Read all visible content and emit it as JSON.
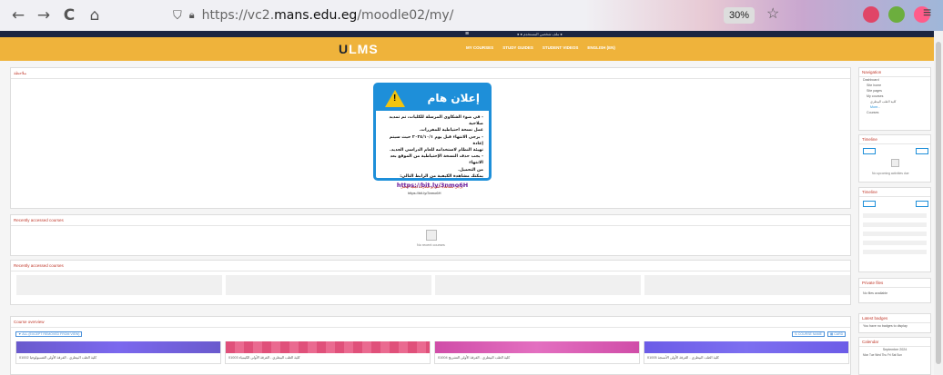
{
  "browser": {
    "back_icon": "←",
    "forward_icon": "→",
    "reload_icon": "C",
    "home_icon": "⌂",
    "url_prefix": "https://vc2.",
    "url_domain": "mans.edu.eg",
    "url_path": "/moodle02/my/",
    "zoom": "30%",
    "star_icon": "☆",
    "menu_icon": "≡"
  },
  "site": {
    "logo_main": "U",
    "logo_text": "LMS",
    "nav_items": [
      "MY COURSES",
      "STUDY GUIDES",
      "STUDENT VIDEOS",
      "ENGLISH (EN)"
    ],
    "user_area": "● ● ملف شخصي المستخدم ●"
  },
  "announcement_panel": {
    "heading": "ملاحظة",
    "title": "إعلان هام",
    "lines": [
      "- في ضوء الشكاوى المرسلة للكليات، تم تمديد صلاحية",
      "عمل نسخة احتياطية للمقررات.",
      "- يرجى الانتهاء قبل يوم ٢٠٢٤/١٠/١ حيث سيتم إعادة",
      "تهيئة النظام لاستخدامه للعام الدراسي الجديد.",
      "- يجب حذف النسخة الإحتياطية من الموقع بعد الانتهاء",
      "من التحميل.",
      "يمكنك مشاهدة الكيفية من الرابط التالي:"
    ],
    "link": "https://bit.ly/3nmo6H",
    "caption_ar": "يرجى مشاهدة الفيديو لمعرفة كيفية العمل",
    "caption_link": "https://bit.ly/3nmo6H"
  },
  "recent_courses": {
    "heading": "Recently accessed courses",
    "empty_text": "No recent courses"
  },
  "recent_items": {
    "heading": "Recently accessed courses"
  },
  "course_overview": {
    "heading": "Course overview",
    "filter_label": "▼ ALL (EXCEPT REMOVED FROM VIEW)",
    "sort_label": "⇅ COURSE NAME",
    "view_label": "▦ CARD",
    "cards": [
      {
        "line1": "كلية الطب البيطري - الفرقة الأولى",
        "line2": "الفسيولوجيا 01002"
      },
      {
        "line1": "كلية الطب البيطري - الفرقة الأولى",
        "line2": "الكيمياء 01003"
      },
      {
        "line1": "كلية الطب البيطري - الفرقة الأولى",
        "line2": "التشريح 01004"
      },
      {
        "line1": "كلية الطب البيطري - الفرقة الأولى",
        "line2": "الأنسجة 01005"
      }
    ]
  },
  "sidebar": {
    "navigation": {
      "heading": "Navigation",
      "items": [
        "Dashboard",
        "Site home",
        "Site pages",
        "My courses",
        "كلية الطب البيطري",
        "More...",
        "Courses"
      ]
    },
    "timeline1": {
      "heading": "Timeline",
      "empty_text": "No upcoming activities due"
    },
    "timeline2": {
      "heading": "Timeline"
    },
    "private_files": {
      "heading": "Private files",
      "text": "No files available"
    },
    "latest_badges": {
      "heading": "Latest badges",
      "text": "You have no badges to display"
    },
    "calendar": {
      "heading": "Calendar",
      "month": "September 2024",
      "days": "Mon Tue Wed Thu Fri Sat Sun"
    }
  },
  "colors": {
    "header": "#efb33b",
    "topbar": "#1b2540",
    "announce_border": "#1e8fd9",
    "block_heading": "#c0392b"
  }
}
